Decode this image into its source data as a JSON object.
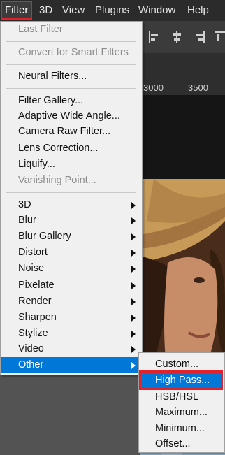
{
  "menubar": {
    "items": [
      "Filter",
      "3D",
      "View",
      "Plugins",
      "Window",
      "Help"
    ]
  },
  "ruler": {
    "ticks": [
      "3000",
      "3500"
    ]
  },
  "filter_menu": {
    "last_filter": "Last Filter",
    "convert_smart": "Convert for Smart Filters",
    "neural_filters": "Neural Filters...",
    "filter_gallery": "Filter Gallery...",
    "adaptive_wide_angle": "Adaptive Wide Angle...",
    "camera_raw": "Camera Raw Filter...",
    "lens_correction": "Lens Correction...",
    "liquify": "Liquify...",
    "vanishing_point": "Vanishing Point...",
    "groups": [
      "3D",
      "Blur",
      "Blur Gallery",
      "Distort",
      "Noise",
      "Pixelate",
      "Render",
      "Sharpen",
      "Stylize",
      "Video",
      "Other"
    ]
  },
  "other_submenu": {
    "items": [
      "Custom...",
      "High Pass...",
      "HSB/HSL",
      "Maximum...",
      "Minimum...",
      "Offset..."
    ]
  },
  "colors": {
    "menubar_bg": "#2b2b2b",
    "menu_bg": "#f0f0f0",
    "selection": "#0078d7",
    "highlight_outline": "#e3212a"
  }
}
